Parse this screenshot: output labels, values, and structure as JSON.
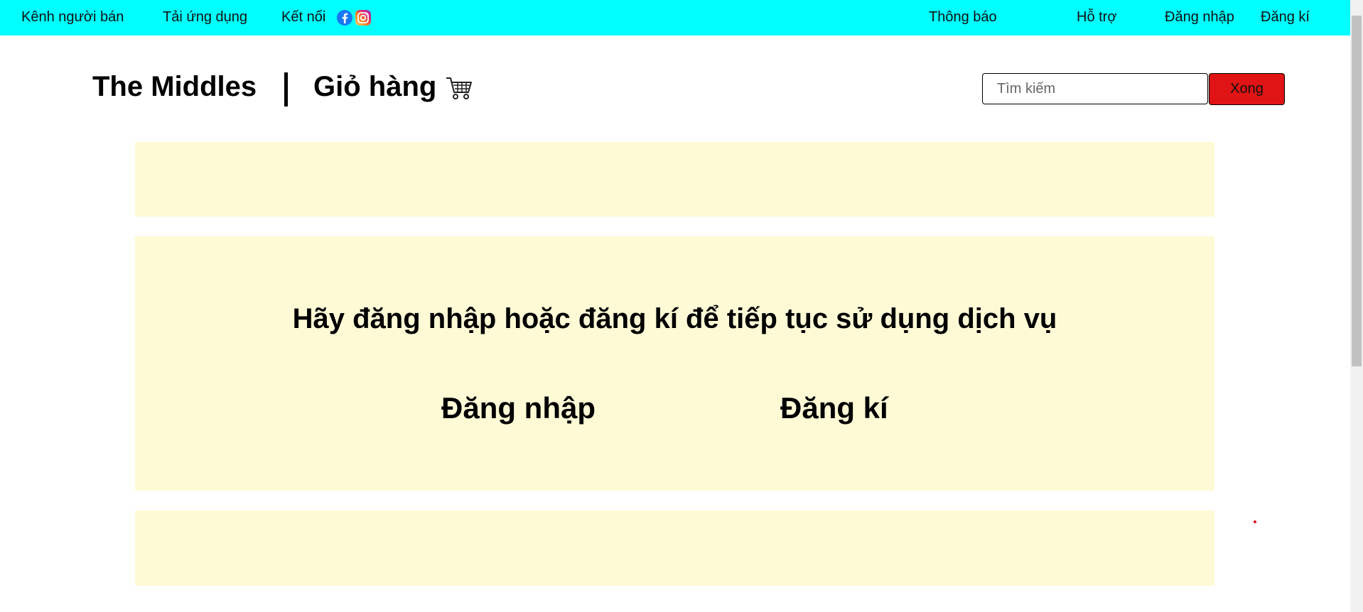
{
  "topbar": {
    "seller_channel": "Kênh người bán",
    "download_app": "Tải ứng dụng",
    "connect": "Kết nối",
    "notifications": "Thông báo",
    "support": "Hỗ trợ",
    "login": "Đăng nhập",
    "register": "Đăng kí",
    "background_color": "#00ffff"
  },
  "header": {
    "brand": "The Middles",
    "cart_label": "Giỏ hàng"
  },
  "search": {
    "placeholder": "Tìm kiếm",
    "button_label": "Xong",
    "button_color": "#e01414"
  },
  "main": {
    "prompt": "Hãy đăng nhập hoặc đăng kí để tiếp tục sử dụng dịch vụ",
    "login_label": "Đăng nhập",
    "register_label": "Đăng kí",
    "panel_color": "#fefad6"
  }
}
